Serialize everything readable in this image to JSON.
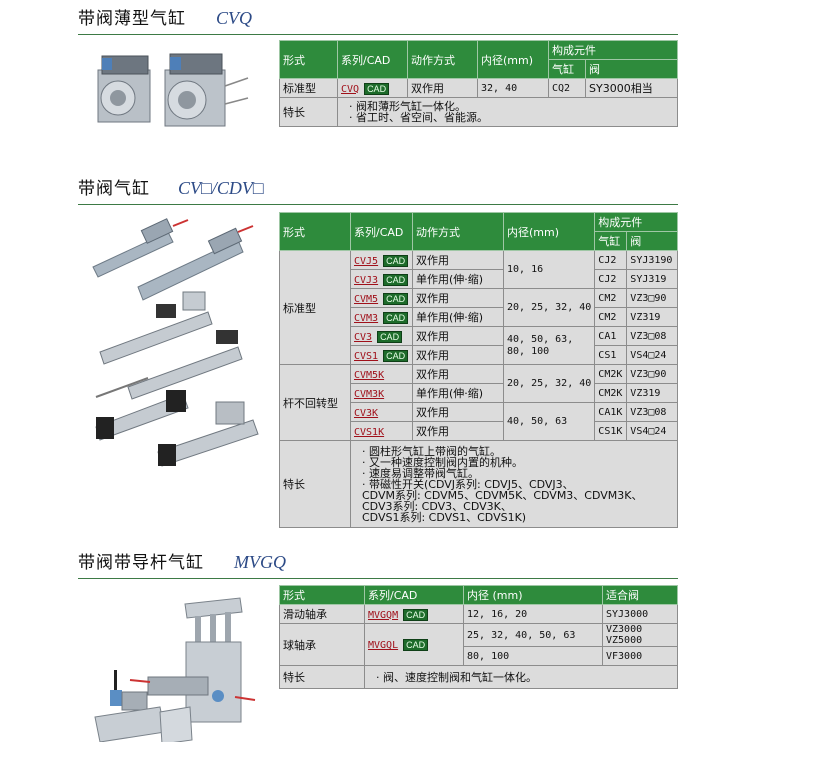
{
  "sections": [
    {
      "title": "带阀薄型气缸",
      "code": "CVQ",
      "image": "cylinder-product-photo",
      "table": {
        "headers": {
          "type": "形式",
          "series": "系列/CAD",
          "action": "动作方式",
          "bore": "内径(mm)",
          "components": "构成元件",
          "cylinder": "气缸",
          "valve": "阀"
        },
        "rows": [
          {
            "type": "标准型",
            "series": "CVQ",
            "cad": "CAD",
            "action": "双作用",
            "bore": "32, 40",
            "cylinder": "CQ2",
            "valve": "SY3000相当"
          }
        ],
        "features_label": "特长",
        "features": [
          "阀和薄形气缸一体化。",
          "省工时、省空间、省能源。"
        ]
      }
    },
    {
      "title": "带阀气缸",
      "code": "CV□/CDV□",
      "image": "cylinder-product-photo",
      "table": {
        "headers": {
          "type": "形式",
          "series": "系列/CAD",
          "action": "动作方式",
          "bore": "内径(mm)",
          "components": "构成元件",
          "cylinder": "气缸",
          "valve": "阀"
        },
        "groups": [
          {
            "type": "标准型",
            "rows": [
              {
                "series": "CVJ5",
                "cad": "CAD",
                "action": "双作用",
                "cylinder": "CJ2",
                "valve": "SYJ3190"
              },
              {
                "series": "CVJ3",
                "cad": "CAD",
                "action": "单作用(伸·缩)",
                "cylinder": "CJ2",
                "valve": "SYJ319"
              },
              {
                "series": "CVM5",
                "cad": "CAD",
                "action": "双作用",
                "cylinder": "CM2",
                "valve": "VZ3□90"
              },
              {
                "series": "CVM3",
                "cad": "CAD",
                "action": "单作用(伸·缩)",
                "cylinder": "CM2",
                "valve": "VZ319"
              },
              {
                "series": "CV3",
                "cad": "CAD",
                "action": "双作用",
                "cylinder": "CA1",
                "valve": "VZ3□08"
              },
              {
                "series": "CVS1",
                "cad": "CAD",
                "action": "双作用",
                "cylinder": "CS1",
                "valve": "VS4□24"
              }
            ],
            "bores": [
              "10, 16",
              "20, 25, 32, 40",
              "40, 50, 63, 80, 100"
            ]
          },
          {
            "type": "杆不回转型",
            "rows": [
              {
                "series": "CVM5K",
                "action": "双作用",
                "cylinder": "CM2K",
                "valve": "VZ3□90"
              },
              {
                "series": "CVM3K",
                "action": "单作用(伸·缩)",
                "cylinder": "CM2K",
                "valve": "VZ319"
              },
              {
                "series": "CV3K",
                "action": "双作用",
                "cylinder": "CA1K",
                "valve": "VZ3□08"
              },
              {
                "series": "CVS1K",
                "action": "双作用",
                "cylinder": "CS1K",
                "valve": "VS4□24"
              }
            ],
            "bores": [
              "20, 25, 32, 40",
              "40, 50, 63"
            ]
          }
        ],
        "features_label": "特长",
        "features": [
          "圆柱形气缸上带阀的气缸。",
          "又一种速度控制阀内置的机种。",
          "速度易调整带阀气缸。",
          "带磁性开关(CDVJ系列: CDVJ5、CDVJ3、",
          "CDVM系列: CDVM5、CDVM5K、CDVM3、CDVM3K、",
          "CDV3系列: CDV3、CDV3K、",
          "CDVS1系列: CDVS1、CDVS1K)"
        ]
      }
    },
    {
      "title": "带阀带导杆气缸",
      "code": "MVGQ",
      "image": "guided-cylinder-product-photo",
      "table": {
        "headers": {
          "type": "形式",
          "series": "系列/CAD",
          "bore": "内径 (mm)",
          "valve": "适合阀"
        },
        "rows": [
          {
            "type": "滑动轴承",
            "series": "MVGQM",
            "cad": "CAD"
          },
          {
            "type": "球轴承",
            "series": "MVGQL",
            "cad": "CAD"
          }
        ],
        "bore_rows": [
          {
            "bore": "12, 16, 20",
            "valve": "SYJ3000"
          },
          {
            "bore": "25, 32, 40, 50, 63",
            "valve": "VZ3000",
            "valve2": "VZ5000"
          },
          {
            "bore": "80, 100",
            "valve": "VF3000"
          }
        ],
        "features_label": "特长",
        "features": [
          "阀、速度控制阀和气缸一体化。"
        ]
      }
    }
  ],
  "colors": {
    "header_green": "#2e8b3c",
    "cell_gray": "#dcdcdc",
    "link_red": "#a0101a",
    "code_blue": "#2c4a86"
  }
}
